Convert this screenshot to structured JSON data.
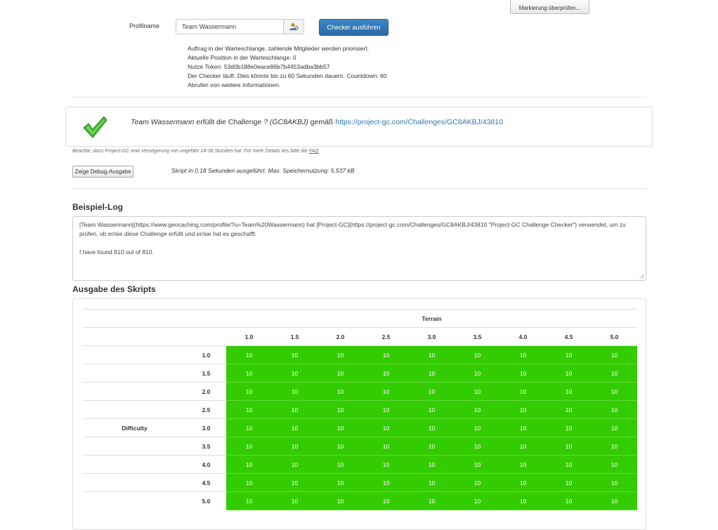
{
  "top_button": "Markierung überprüfen...",
  "profile": {
    "label": "Profilname",
    "value": "Team Wassermann",
    "icon": "user-lookup-icon"
  },
  "run_button": "Checker ausführen",
  "status_lines": [
    "Auftrag in der Warteschlange, zahlende Mitglieder werden priorisiert.",
    "Aktuelle Position in der Warteschlange: 0",
    "Nutze Token: 53d0b188e0eace86b7b4453adba3bb57",
    "Der Checker läuft. Dies könnte bis zu 60 Sekunden dauern. Countdown: 60",
    "Abrufen von weitere Informationen."
  ],
  "result": {
    "icon": "green-checkmark-icon",
    "profile": "Team Wassermann",
    "text_mid": " erfüllt die Challenge ",
    "challenge": "? (GC8AKBJ)",
    "text_pre_link": " gemäß ",
    "link": "https://project-gc.com/Challenges/GC8AKBJ/43810"
  },
  "note": {
    "text": "Beachte, dass Project-GC eine Verzögerung von ungefähr 24-36 Stunden hat. Für mehr Details lies bitte die ",
    "faq": "FAQ"
  },
  "debug_button": "Zeige Debug-Ausgabe",
  "runtime": "Skript in 0.18 Sekunden ausgeführt. Max. Speichernutzung: 5,537 kB",
  "log": {
    "heading": "Beispiel-Log",
    "line1": "[Team Wassermann](https://www.geocaching.com/profile/?u=Team%20Wassermann) hat [Project-GC](https://project-gc.com/Challenges/GC8AKBJ/43810 \"Project-GC Challenge Checker\") verwendet, um zu prüfen, ob er/sie diese Challenge erfüllt und er/sie hat es geschafft.",
    "line2": "I have found 810 out of 810."
  },
  "output": {
    "heading": "Ausgabe des Skripts",
    "col_header": "Terrain",
    "row_header": "Difficulty",
    "terrain": [
      "1.0",
      "1.5",
      "2.0",
      "2.5",
      "3.0",
      "3.5",
      "4.0",
      "4.5",
      "5.0"
    ],
    "difficulty": [
      "1.0",
      "1.5",
      "2.0",
      "2.5",
      "3.0",
      "3.5",
      "4.0",
      "4.5",
      "5.0"
    ],
    "cells": [
      [
        "10",
        "10",
        "10",
        "10",
        "10",
        "10",
        "10",
        "10",
        "10"
      ],
      [
        "10",
        "10",
        "10",
        "10",
        "10",
        "10",
        "10",
        "10",
        "10"
      ],
      [
        "10",
        "10",
        "10",
        "10",
        "10",
        "10",
        "10",
        "10",
        "10"
      ],
      [
        "10",
        "10",
        "10",
        "10",
        "10",
        "10",
        "10",
        "10",
        "10"
      ],
      [
        "10",
        "10",
        "10",
        "10",
        "10",
        "10",
        "10",
        "10",
        "10"
      ],
      [
        "10",
        "10",
        "10",
        "10",
        "10",
        "10",
        "10",
        "10",
        "10"
      ],
      [
        "10",
        "10",
        "10",
        "10",
        "10",
        "10",
        "10",
        "10",
        "10"
      ],
      [
        "10",
        "10",
        "10",
        "10",
        "10",
        "10",
        "10",
        "10",
        "10"
      ],
      [
        "10",
        "10",
        "10",
        "10",
        "10",
        "10",
        "10",
        "10",
        "10"
      ]
    ],
    "cell_color": "#33cc00"
  }
}
